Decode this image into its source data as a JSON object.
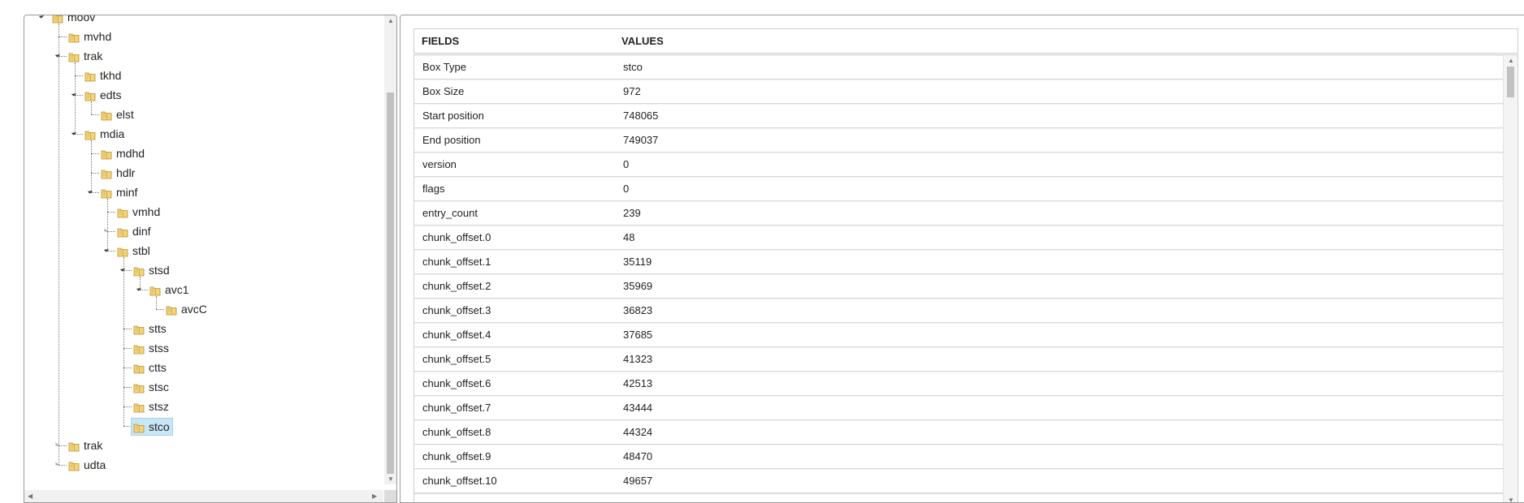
{
  "tree": {
    "nodes": [
      {
        "label": "moov",
        "depth": 0,
        "expanded": true
      },
      {
        "label": "mvhd",
        "depth": 1,
        "expanded": null
      },
      {
        "label": "trak",
        "depth": 1,
        "expanded": true
      },
      {
        "label": "tkhd",
        "depth": 2,
        "expanded": null
      },
      {
        "label": "edts",
        "depth": 2,
        "expanded": true
      },
      {
        "label": "elst",
        "depth": 3,
        "expanded": null
      },
      {
        "label": "mdia",
        "depth": 2,
        "expanded": true
      },
      {
        "label": "mdhd",
        "depth": 3,
        "expanded": null
      },
      {
        "label": "hdlr",
        "depth": 3,
        "expanded": null
      },
      {
        "label": "minf",
        "depth": 3,
        "expanded": true
      },
      {
        "label": "vmhd",
        "depth": 4,
        "expanded": null
      },
      {
        "label": "dinf",
        "depth": 4,
        "expanded": false
      },
      {
        "label": "stbl",
        "depth": 4,
        "expanded": true
      },
      {
        "label": "stsd",
        "depth": 5,
        "expanded": true
      },
      {
        "label": "avc1",
        "depth": 6,
        "expanded": true
      },
      {
        "label": "avcC",
        "depth": 7,
        "expanded": null
      },
      {
        "label": "stts",
        "depth": 5,
        "expanded": null
      },
      {
        "label": "stss",
        "depth": 5,
        "expanded": null
      },
      {
        "label": "ctts",
        "depth": 5,
        "expanded": null
      },
      {
        "label": "stsc",
        "depth": 5,
        "expanded": null
      },
      {
        "label": "stsz",
        "depth": 5,
        "expanded": null
      },
      {
        "label": "stco",
        "depth": 5,
        "expanded": null,
        "selected": true
      },
      {
        "label": "trak",
        "depth": 1,
        "expanded": false
      },
      {
        "label": "udta",
        "depth": 1,
        "expanded": false
      }
    ],
    "selected_color": "#c9e6f7",
    "folder_icon": "folder-icon"
  },
  "table": {
    "headers": {
      "fields": "FIELDS",
      "values": "VALUES"
    },
    "rows": [
      {
        "field": "Box Type",
        "value": "stco"
      },
      {
        "field": "Box Size",
        "value": "972"
      },
      {
        "field": "Start position",
        "value": "748065"
      },
      {
        "field": "End position",
        "value": "749037"
      },
      {
        "field": "version",
        "value": "0"
      },
      {
        "field": "flags",
        "value": "0"
      },
      {
        "field": "entry_count",
        "value": "239"
      },
      {
        "field": "chunk_offset.0",
        "value": "48"
      },
      {
        "field": "chunk_offset.1",
        "value": "35119"
      },
      {
        "field": "chunk_offset.2",
        "value": "35969"
      },
      {
        "field": "chunk_offset.3",
        "value": "36823"
      },
      {
        "field": "chunk_offset.4",
        "value": "37685"
      },
      {
        "field": "chunk_offset.5",
        "value": "41323"
      },
      {
        "field": "chunk_offset.6",
        "value": "42513"
      },
      {
        "field": "chunk_offset.7",
        "value": "43444"
      },
      {
        "field": "chunk_offset.8",
        "value": "44324"
      },
      {
        "field": "chunk_offset.9",
        "value": "48470"
      },
      {
        "field": "chunk_offset.10",
        "value": "49657"
      }
    ]
  }
}
